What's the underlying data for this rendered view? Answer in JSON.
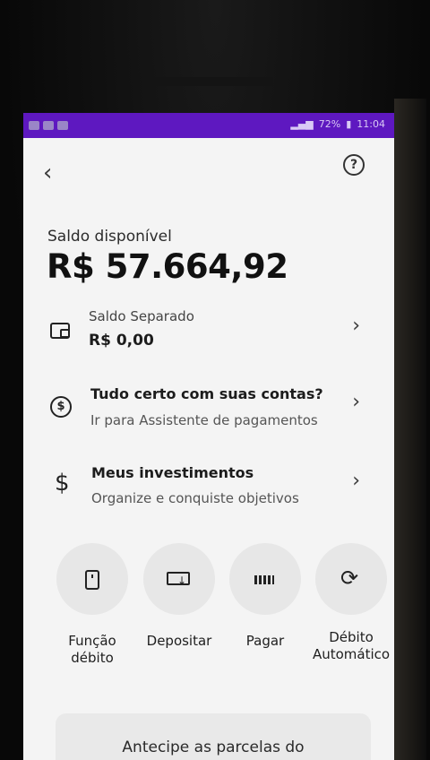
{
  "status_bar": {
    "battery": "72%",
    "time": "11:04"
  },
  "header": {
    "back_icon": "chevron-left-icon",
    "help_icon": "help-circle-icon",
    "help_glyph": "?"
  },
  "balance": {
    "label": "Saldo disponível",
    "value": "R$ 57.664,92"
  },
  "rows": [
    {
      "icon": "wallet-icon",
      "title": "Saldo Separado",
      "subtitle": "R$ 0,00"
    },
    {
      "icon": "payment-cycle-icon",
      "title": "Tudo certo com suas contas?",
      "subtitle": "Ir para Assistente de pagamentos"
    },
    {
      "icon": "dollar-icon",
      "title": "Meus investimentos",
      "subtitle": "Organize e conquiste objetivos"
    }
  ],
  "actions": [
    {
      "icon": "card-icon",
      "label_line1": "Função",
      "label_line2": "débito"
    },
    {
      "icon": "deposit-icon",
      "label_line1": "Depositar",
      "label_line2": ""
    },
    {
      "icon": "barcode-icon",
      "label_line1": "Pagar",
      "label_line2": ""
    },
    {
      "icon": "sync-icon",
      "label_line1": "Débito",
      "label_line2": "Automático"
    }
  ],
  "promo": {
    "text": "Antecipe as parcelas do"
  },
  "colors": {
    "status_bar": "#5e18c0",
    "screen_bg": "#f4f4f4",
    "action_bg": "#e7e7e7"
  }
}
